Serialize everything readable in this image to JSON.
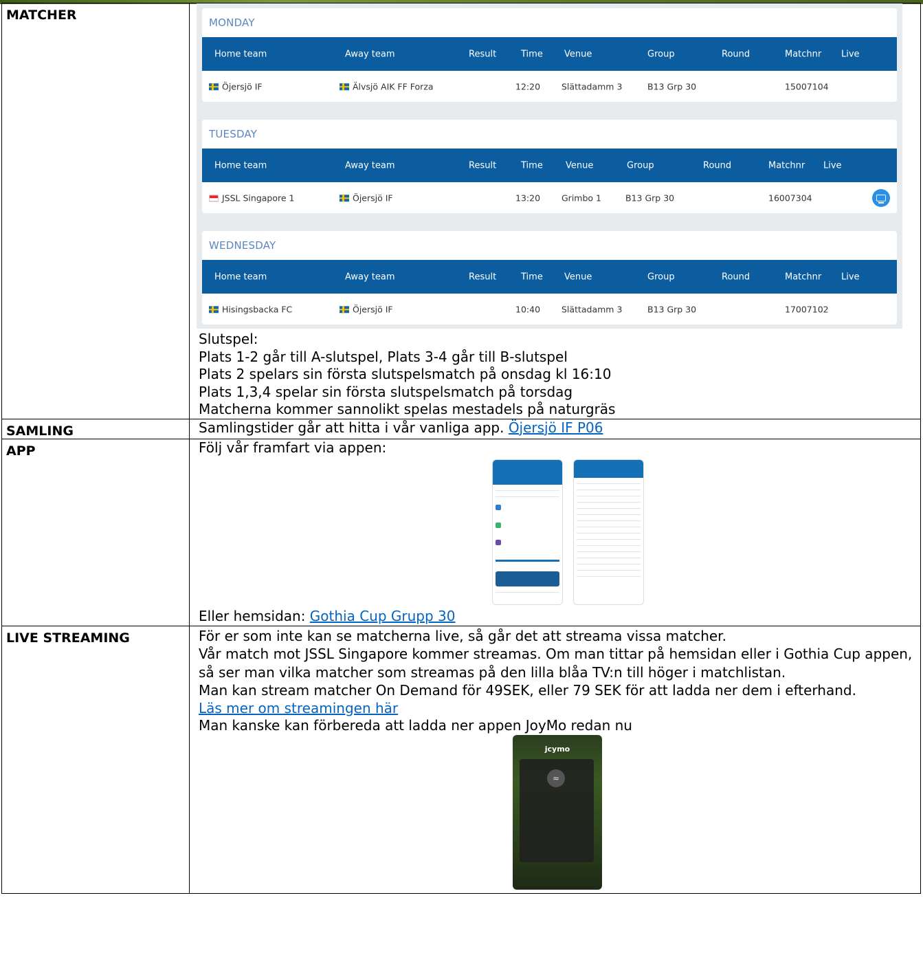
{
  "rows": {
    "matcher": {
      "label": "MATCHER",
      "schedule": {
        "days": [
          {
            "title": "MONDAY",
            "headers": [
              "Home team",
              "Away team",
              "Result",
              "Time",
              "Venue",
              "Group",
              "Round",
              "Matchnr",
              "Live"
            ],
            "match": {
              "home": "Öjersjö IF",
              "home_flag": "se",
              "away": "Älvsjö AIK FF Forza",
              "away_flag": "se",
              "result": "",
              "time": "12:20",
              "venue": "Slättadamm 3",
              "group": "B13 Grp 30",
              "round": "",
              "matchnr": "15007104",
              "live": false
            }
          },
          {
            "title": "TUESDAY",
            "headers": [
              "Home team",
              "Away team",
              "Result",
              "Time",
              "Venue",
              "Group",
              "Round",
              "Matchnr",
              "Live"
            ],
            "match": {
              "home": "JSSL Singapore 1",
              "home_flag": "sg",
              "away": "Öjersjö IF",
              "away_flag": "se",
              "result": "",
              "time": "13:20",
              "venue": "Grimbo 1",
              "group": "B13 Grp 30",
              "round": "",
              "matchnr": "16007304",
              "live": true
            }
          },
          {
            "title": "WEDNESDAY",
            "headers": [
              "Home team",
              "Away team",
              "Result",
              "Time",
              "Venue",
              "Group",
              "Round",
              "Matchnr",
              "Live"
            ],
            "match": {
              "home": "Hisingsbacka FC",
              "home_flag": "se",
              "away": "Öjersjö IF",
              "away_flag": "se",
              "result": "",
              "time": "10:40",
              "venue": "Slättadamm 3",
              "group": "B13 Grp 30",
              "round": "",
              "matchnr": "17007102",
              "live": false
            }
          }
        ]
      },
      "notes": [
        "Slutspel:",
        "Plats 1-2 går till A-slutspel, Plats 3-4 går till B-slutspel",
        "Plats 2 spelars sin första slutspelsmatch på onsdag kl 16:10",
        "Plats 1,3,4 spelar sin första slutspelsmatch på torsdag",
        "Matcherna kommer sannolikt spelas mestadels på naturgräs"
      ]
    },
    "samling": {
      "label": "SAMLING",
      "text": "Samlingstider går att hitta i vår vanliga app. ",
      "link": "Öjersjö IF P06"
    },
    "app": {
      "label": "APP",
      "intro": "Följ vår framfart via appen:",
      "outro": "Eller hemsidan: ",
      "link": "Gothia Cup Grupp 30"
    },
    "live": {
      "label": "LIVE STREAMING",
      "p1": "För er som inte kan se matcherna live, så går det att streama vissa matcher.",
      "p2": "Vår match mot JSSL Singapore kommer streamas. Om man tittar på hemsidan eller i Gothia Cup appen, så ser man vilka matcher som streamas på den lilla blåa TV:n till höger i matchlistan.",
      "p3": "Man kan stream matcher On Demand för 49SEK, eller 79 SEK för att ladda ner dem i efterhand.",
      "link": "Läs mer om streamingen här",
      "p4": "Man kanske kan förbereda att ladda ner appen JoyMo redan nu"
    }
  }
}
